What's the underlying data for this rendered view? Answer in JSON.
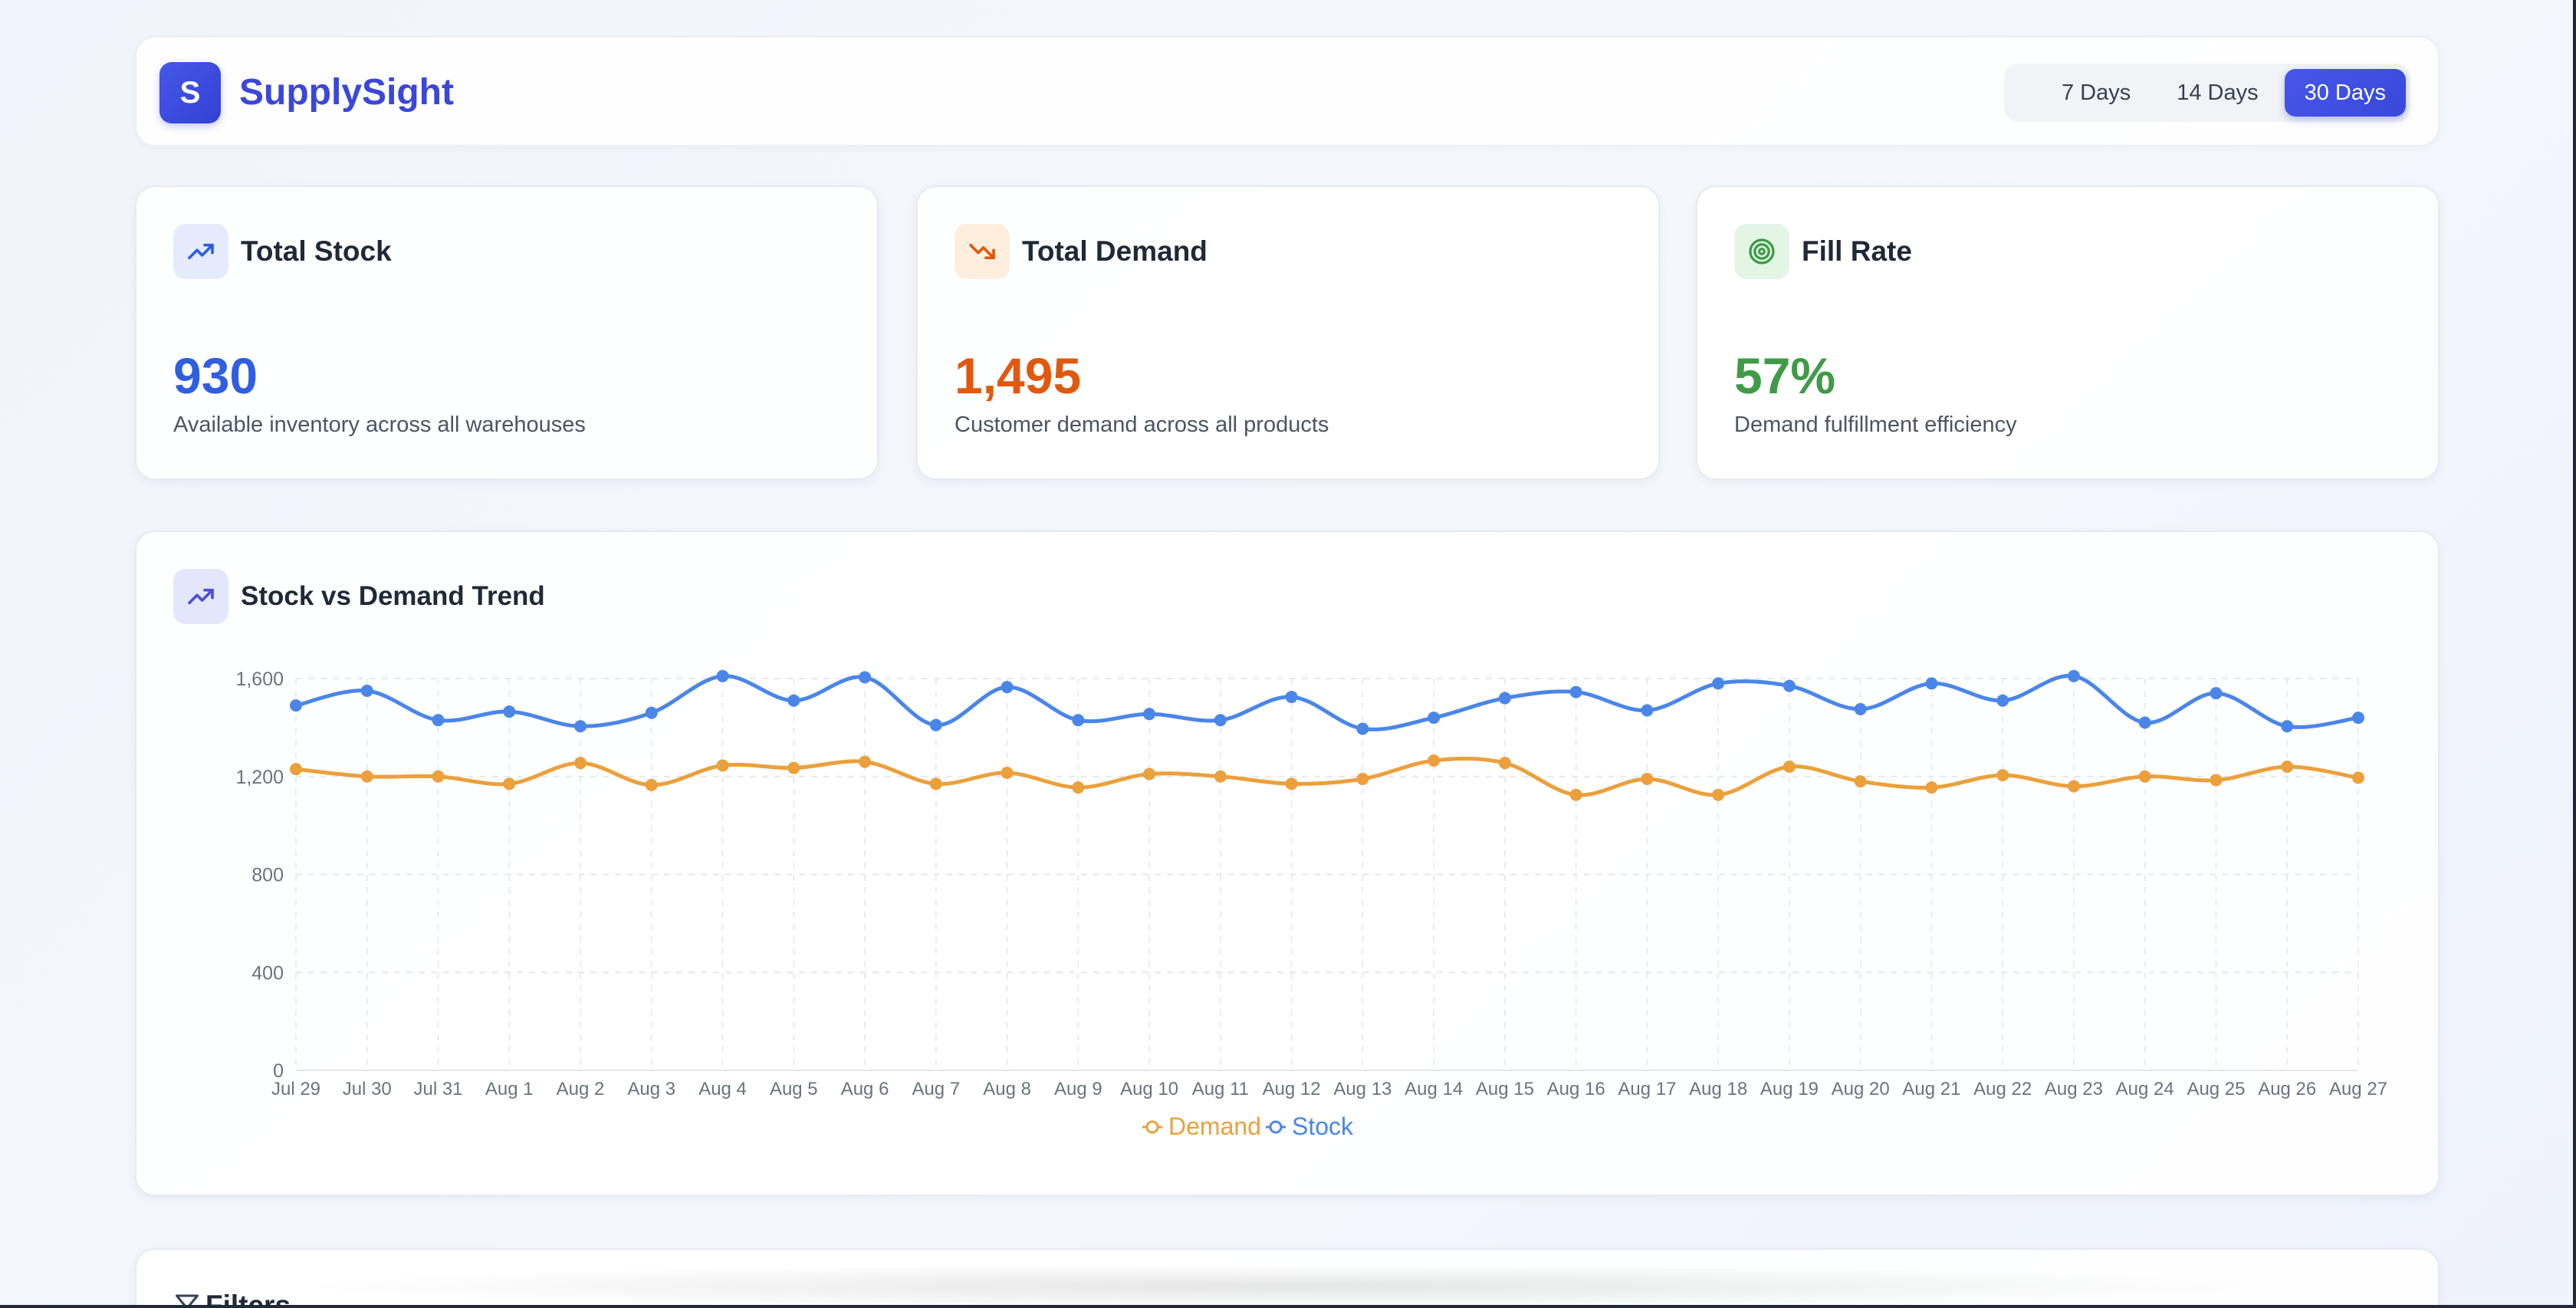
{
  "app": {
    "logo_letter": "S",
    "brand_name": "SupplySight"
  },
  "range": {
    "options": [
      "7 Days",
      "14 Days",
      "30 Days"
    ],
    "selected": "30 Days"
  },
  "kpis": [
    {
      "title": "Total Stock",
      "value": "930",
      "description": "Available inventory across all warehouses",
      "icon": "trending-up-icon",
      "color": "#2f5fe0",
      "icon_bg": "#e3ebfd"
    },
    {
      "title": "Total Demand",
      "value": "1,495",
      "description": "Customer demand across all products",
      "icon": "trending-down-icon",
      "color": "#e0590f",
      "icon_bg": "#feeedd"
    },
    {
      "title": "Fill Rate",
      "value": "57%",
      "description": "Demand fulfillment efficiency",
      "icon": "target-icon",
      "color": "#3f9b47",
      "icon_bg": "#e3f6e6"
    }
  ],
  "chart_panel": {
    "title": "Stock vs Demand Trend",
    "icon": "trending-up-icon",
    "icon_color": "#4b4fd8"
  },
  "filters": {
    "title": "Filters",
    "icon": "filter-icon"
  },
  "chart_data": {
    "type": "line",
    "categories": [
      "Jul 29",
      "Jul 30",
      "Jul 31",
      "Aug 1",
      "Aug 2",
      "Aug 3",
      "Aug 4",
      "Aug 5",
      "Aug 6",
      "Aug 7",
      "Aug 8",
      "Aug 9",
      "Aug 10",
      "Aug 11",
      "Aug 12",
      "Aug 13",
      "Aug 14",
      "Aug 15",
      "Aug 16",
      "Aug 17",
      "Aug 18",
      "Aug 19",
      "Aug 20",
      "Aug 21",
      "Aug 22",
      "Aug 23",
      "Aug 24",
      "Aug 25",
      "Aug 26",
      "Aug 27"
    ],
    "series": [
      {
        "name": "Stock",
        "color": "#4a86e8",
        "values": [
          1490,
          1550,
          1430,
          1465,
          1405,
          1460,
          1610,
          1510,
          1605,
          1410,
          1565,
          1430,
          1455,
          1430,
          1525,
          1395,
          1440,
          1520,
          1545,
          1470,
          1580,
          1570,
          1475,
          1580,
          1510,
          1610,
          1420,
          1540,
          1405,
          1440
        ]
      },
      {
        "name": "Demand",
        "color": "#eba03c",
        "values": [
          1230,
          1200,
          1200,
          1170,
          1255,
          1165,
          1245,
          1235,
          1260,
          1170,
          1215,
          1155,
          1210,
          1200,
          1170,
          1190,
          1265,
          1255,
          1125,
          1190,
          1125,
          1240,
          1180,
          1155,
          1205,
          1160,
          1200,
          1185,
          1240,
          1195
        ]
      }
    ],
    "legend_order": [
      "Demand",
      "Stock"
    ],
    "y_ticks": [
      0,
      400,
      800,
      1200,
      1600
    ],
    "ylim": [
      0,
      1600
    ],
    "grid": true,
    "legend_position": "bottom-center"
  }
}
